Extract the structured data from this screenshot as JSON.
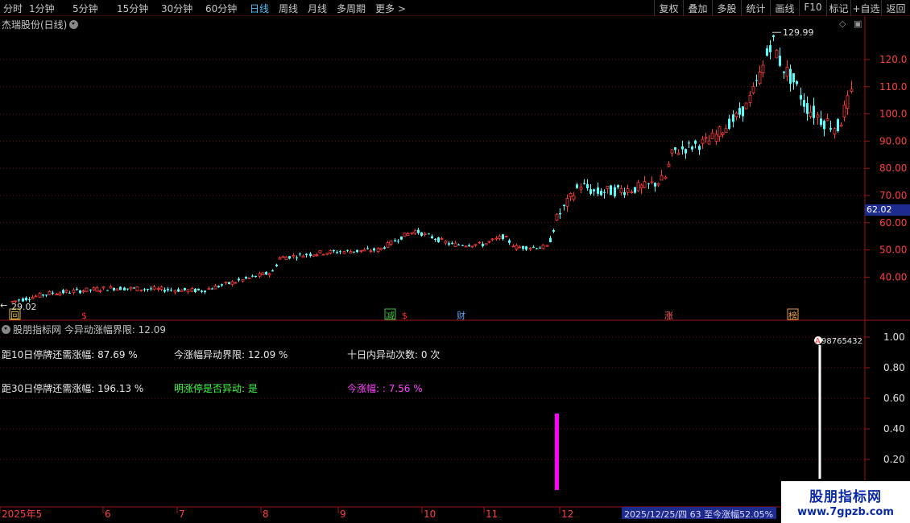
{
  "toolbar": {
    "periods": [
      "分时",
      "1分钟",
      "5分钟",
      "15分钟",
      "30分钟",
      "60分钟",
      "日线",
      "周线",
      "月线",
      "多周期",
      "更多 >"
    ],
    "active_period": "日线",
    "right_buttons": [
      "复权",
      "叠加",
      "多股",
      "统计",
      "画线",
      "F10",
      "标记",
      "+自选",
      "返回"
    ]
  },
  "main": {
    "title": "杰瑞股份(日线)",
    "max_label": "129.99",
    "min_label": "29.02",
    "current_price": "62.02",
    "y_ticks": [
      "120.0",
      "110.0",
      "100.0",
      "90.00",
      "80.00",
      "70.00",
      "60.00",
      "50.00",
      "40.00"
    ],
    "markers": [
      {
        "text": "回",
        "color": "#e0c040",
        "kind": "box"
      },
      {
        "text": "$",
        "color": "#ff3030",
        "kind": "text"
      },
      {
        "text": "减",
        "color": "#40c040",
        "kind": "box"
      },
      {
        "text": "$",
        "color": "#ff3030",
        "kind": "text"
      },
      {
        "text": "财",
        "color": "#60a8ff",
        "kind": "text"
      },
      {
        "text": "涨",
        "color": "#ff6060",
        "kind": "text"
      },
      {
        "text": "榜",
        "color": "#e0a040",
        "kind": "box"
      }
    ],
    "colors": {
      "up": "#ff3c3c",
      "down": "#54ffff",
      "grid": "#6a0f0f",
      "axis": "#a01414"
    }
  },
  "sub": {
    "title": "股朋指标网 今异动涨幅界限: 12.09",
    "line1": {
      "col1": "距10日停牌还需涨幅: 87.69 %",
      "col2": "今涨幅异动界限: 12.09 %",
      "col3": "十日内异动次数: 0 次"
    },
    "line2": {
      "col1": "距30日停牌还需涨幅: 196.13 %",
      "col2": "明涨停是否异动: 是",
      "col3": "今涨幅: : 7.56 %"
    },
    "y_ticks": [
      "1.00",
      "0.80",
      "0.60",
      "0.40",
      "0.20"
    ],
    "signal_label": "98765432",
    "signal_value": 1.0,
    "magenta_bar_value": 0.5,
    "colors": {
      "col2_line2": "#40ff40",
      "col3_line2": "#ff40ff",
      "magenta": "#ff00ff"
    }
  },
  "x_axis": {
    "labels": [
      "2025年5",
      "6",
      "7",
      "8",
      "9",
      "10",
      "11",
      "12"
    ]
  },
  "status": "2025/12/25/四 63 至今涨幅52.05%",
  "watermark": {
    "title": "股朋指标网",
    "url": "www.7gpzb.com"
  }
}
